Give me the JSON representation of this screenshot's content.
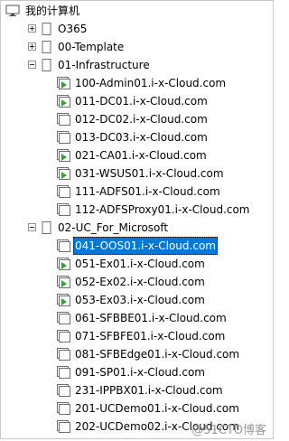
{
  "tree": {
    "root": {
      "label": "我的计算机",
      "icon": "monitor-icon"
    },
    "groups": [
      {
        "label": "O365",
        "expander": "plus",
        "icon": "folder-icon",
        "vms": []
      },
      {
        "label": "00-Template",
        "expander": "plus",
        "icon": "folder-icon",
        "vms": []
      },
      {
        "label": "01-Infrastructure",
        "expander": "minus",
        "icon": "folder-icon",
        "vms": [
          {
            "label": "100-Admin01.i-x-Cloud.com",
            "state": "running"
          },
          {
            "label": "011-DC01.i-x-Cloud.com",
            "state": "running"
          },
          {
            "label": "012-DC02.i-x-Cloud.com",
            "state": "off"
          },
          {
            "label": "013-DC03.i-x-Cloud.com",
            "state": "off"
          },
          {
            "label": "021-CA01.i-x-Cloud.com",
            "state": "running"
          },
          {
            "label": "031-WSUS01.i-x-Cloud.com",
            "state": "running"
          },
          {
            "label": "111-ADFS01.i-x-Cloud.com",
            "state": "off"
          },
          {
            "label": "112-ADFSProxy01.i-x-Cloud.com",
            "state": "off"
          }
        ]
      },
      {
        "label": "02-UC_For_Microsoft",
        "expander": "minus",
        "icon": "folder-icon",
        "vms": [
          {
            "label": "041-OOS01.i-x-Cloud.com",
            "state": "off",
            "selected": true
          },
          {
            "label": "051-Ex01.i-x-Cloud.com",
            "state": "running"
          },
          {
            "label": "052-Ex02.i-x-Cloud.com",
            "state": "running"
          },
          {
            "label": "053-Ex03.i-x-Cloud.com",
            "state": "running"
          },
          {
            "label": "061-SFBBE01.i-x-Cloud.com",
            "state": "off"
          },
          {
            "label": "071-SFBFE01.i-x-Cloud.com",
            "state": "off"
          },
          {
            "label": "081-SFBEdge01.i-x-Cloud.com",
            "state": "off"
          },
          {
            "label": "091-SP01.i-x-Cloud.com",
            "state": "off"
          },
          {
            "label": "231-IPPBX01.i-x-Cloud.com",
            "state": "off"
          },
          {
            "label": "201-UCDemo01.i-x-Cloud.com",
            "state": "off"
          },
          {
            "label": "202-UCDemo02.i-x-Cloud.com",
            "state": "off"
          }
        ]
      }
    ]
  },
  "colors": {
    "selection": "#0078d7",
    "running_arrow": "#3aa12e",
    "icon_outline": "#6e6e6e"
  },
  "watermark": "@51CTO博客"
}
